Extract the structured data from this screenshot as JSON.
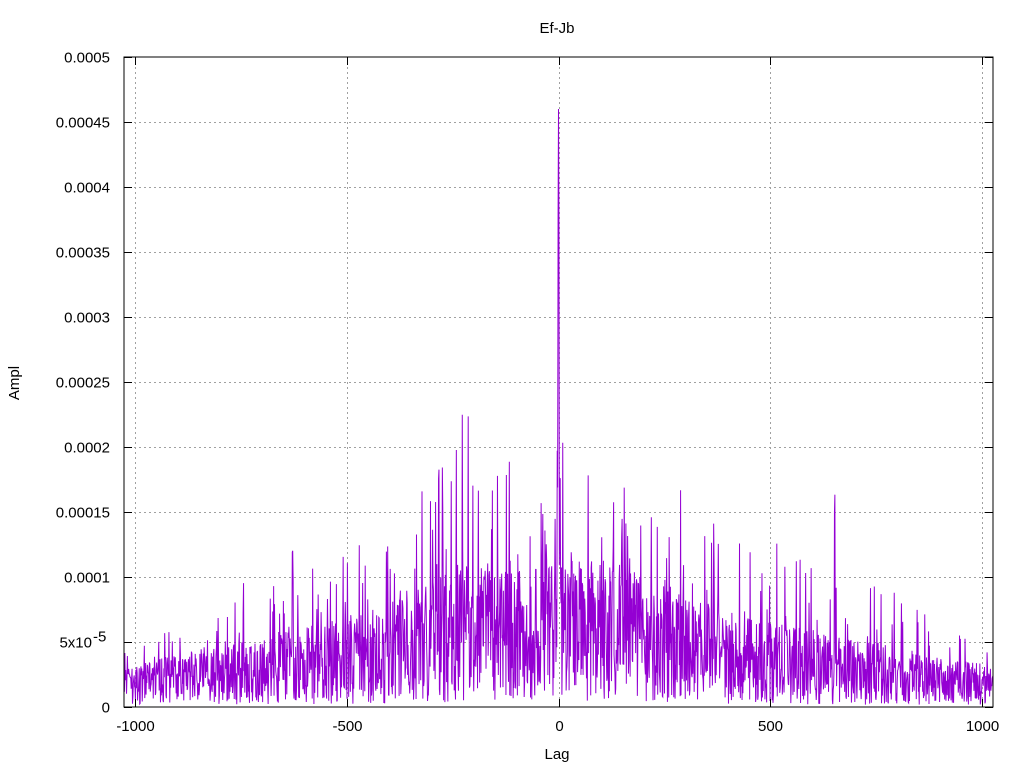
{
  "chart_data": {
    "type": "line",
    "title": "Ef-Jb",
    "xlabel": "Lag",
    "ylabel": "Ampl",
    "xlim": [
      -1025,
      1025
    ],
    "ylim": [
      0,
      0.0005
    ],
    "grid": true,
    "legend": "none",
    "x_ticks": [
      {
        "value": -1000,
        "label": "-1000"
      },
      {
        "value": -500,
        "label": "-500"
      },
      {
        "value": 0,
        "label": "0"
      },
      {
        "value": 500,
        "label": "500"
      },
      {
        "value": 1000,
        "label": "1000"
      }
    ],
    "y_ticks": [
      {
        "value": 0,
        "label": "0"
      },
      {
        "value": 5e-05,
        "label": "5x10",
        "sup": "-5"
      },
      {
        "value": 0.0001,
        "label": "0.0001"
      },
      {
        "value": 0.00015,
        "label": "0.00015"
      },
      {
        "value": 0.0002,
        "label": "0.0002"
      },
      {
        "value": 0.00025,
        "label": "0.00025"
      },
      {
        "value": 0.0003,
        "label": "0.0003"
      },
      {
        "value": 0.00035,
        "label": "0.00035"
      },
      {
        "value": 0.0004,
        "label": "0.0004"
      },
      {
        "value": 0.00045,
        "label": "0.00045"
      },
      {
        "value": 0.0005,
        "label": "0.0005"
      }
    ],
    "series": [
      {
        "color": "#9400d3",
        "x": [
          -1025,
          -1000,
          -975,
          -950,
          -925,
          -900,
          -875,
          -850,
          -825,
          -800,
          -775,
          -750,
          -725,
          -700,
          -675,
          -650,
          -625,
          -600,
          -575,
          -550,
          -525,
          -500,
          -475,
          -450,
          -425,
          -400,
          -375,
          -350,
          -325,
          -300,
          -275,
          -250,
          -225,
          -200,
          -175,
          -150,
          -125,
          -100,
          -75,
          -50,
          -25,
          -10,
          -5,
          -2,
          0,
          2,
          5,
          10,
          25,
          50,
          75,
          100,
          125,
          150,
          175,
          200,
          225,
          250,
          275,
          300,
          325,
          350,
          375,
          400,
          425,
          450,
          475,
          500,
          525,
          550,
          575,
          600,
          625,
          650,
          675,
          700,
          725,
          750,
          775,
          800,
          825,
          850,
          875,
          900,
          925,
          950,
          975,
          1000,
          1025
        ],
        "env_high": [
          4.5e-05,
          5e-05,
          5.5e-05,
          5.5e-05,
          6.5e-05,
          6e-05,
          5.5e-05,
          8.5e-05,
          6e-05,
          7e-05,
          8e-05,
          0.00013,
          0.00011,
          0.00012,
          0.000105,
          0.000125,
          0.000135,
          0.00018,
          0.00013,
          0.000125,
          0.000125,
          0.00013,
          0.00014,
          0.000155,
          0.000165,
          0.00015,
          0.00014,
          0.000125,
          0.00017,
          0.000225,
          0.0002,
          0.000215,
          0.000235,
          0.000225,
          0.000215,
          0.000225,
          0.000225,
          0.000225,
          0.000185,
          0.000175,
          0.000165,
          0.0002,
          0.00025,
          0.000295,
          0.00046,
          0.000295,
          0.00025,
          0.000205,
          0.000185,
          0.000175,
          0.00018,
          0.00017,
          0.000205,
          0.000175,
          0.000165,
          0.00016,
          0.00016,
          0.00015,
          0.00015,
          0.000215,
          0.00014,
          0.000155,
          0.00014,
          0.000205,
          0.000145,
          0.00014,
          0.00013,
          0.00017,
          0.000125,
          0.00012,
          0.000135,
          0.00012,
          0.00012,
          0.000178,
          0.0001,
          0.000105,
          0.0001,
          0.00011,
          0.0001,
          8.5e-05,
          9e-05,
          8.5e-05,
          7.5e-05,
          7e-05,
          6e-05,
          6.5e-05,
          5.5e-05,
          6e-05,
          4e-05
        ],
        "env_mean": [
          2e-05,
          2.2e-05,
          2.4e-05,
          2.5e-05,
          2.7e-05,
          2.7e-05,
          2.8e-05,
          3e-05,
          3.1e-05,
          3.2e-05,
          3.3e-05,
          3.5e-05,
          3.7e-05,
          3.8e-05,
          4e-05,
          4.1e-05,
          4.2e-05,
          4.3e-05,
          4.5e-05,
          4.6e-05,
          4.7e-05,
          4.8e-05,
          5e-05,
          5.2e-05,
          5.4e-05,
          5.6e-05,
          5.8e-05,
          6e-05,
          6.3e-05,
          6.6e-05,
          7e-05,
          7.3e-05,
          7.5e-05,
          7.7e-05,
          7.8e-05,
          7.8e-05,
          7.8e-05,
          7.8e-05,
          7.8e-05,
          7.8e-05,
          7.8e-05,
          9e-05,
          0.00012,
          0.00016,
          0.00028,
          0.00016,
          0.00012,
          9e-05,
          7.8e-05,
          7.8e-05,
          7.8e-05,
          7.8e-05,
          7.7e-05,
          7.5e-05,
          7.3e-05,
          7e-05,
          6.7e-05,
          6.4e-05,
          6.1e-05,
          5.9e-05,
          5.7e-05,
          5.5e-05,
          5.3e-05,
          5.1e-05,
          4.9e-05,
          4.7e-05,
          4.6e-05,
          4.5e-05,
          4.4e-05,
          4.3e-05,
          4.2e-05,
          4.1e-05,
          4e-05,
          3.9e-05,
          3.7e-05,
          3.6e-05,
          3.5e-05,
          3.4e-05,
          3.3e-05,
          3.1e-05,
          3e-05,
          2.9e-05,
          2.8e-05,
          2.7e-05,
          2.6e-05,
          2.5e-05,
          2.4e-05,
          2.3e-05,
          2.2e-05
        ]
      }
    ]
  }
}
